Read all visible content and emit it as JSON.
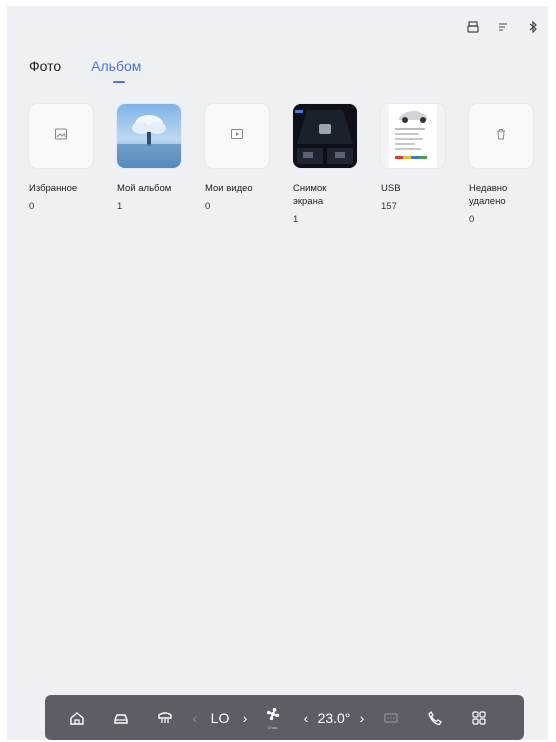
{
  "tabs": {
    "photos": "Фото",
    "albums": "Альбом"
  },
  "albums": [
    {
      "name": "Избранное",
      "count": "0",
      "icon": "image-icon"
    },
    {
      "name": "Мой альбом",
      "count": "1",
      "icon": "cloud-photo-thumbnail"
    },
    {
      "name": "Мои видео",
      "count": "0",
      "icon": "play-icon"
    },
    {
      "name": "Снимок экрана",
      "count": "1",
      "icon": "screenshot-thumbnail"
    },
    {
      "name": "USB",
      "count": "157",
      "icon": "car-document-thumbnail"
    },
    {
      "name": "Недавно удалено",
      "count": "0",
      "icon": "trash-icon"
    }
  ],
  "dock": {
    "fan_level": "LO",
    "fan_caption": "Chan.",
    "temperature": "23.0°"
  },
  "colors": {
    "accent": "#4f73d9",
    "dock": "#5b5e65",
    "background": "#eff0f4"
  }
}
